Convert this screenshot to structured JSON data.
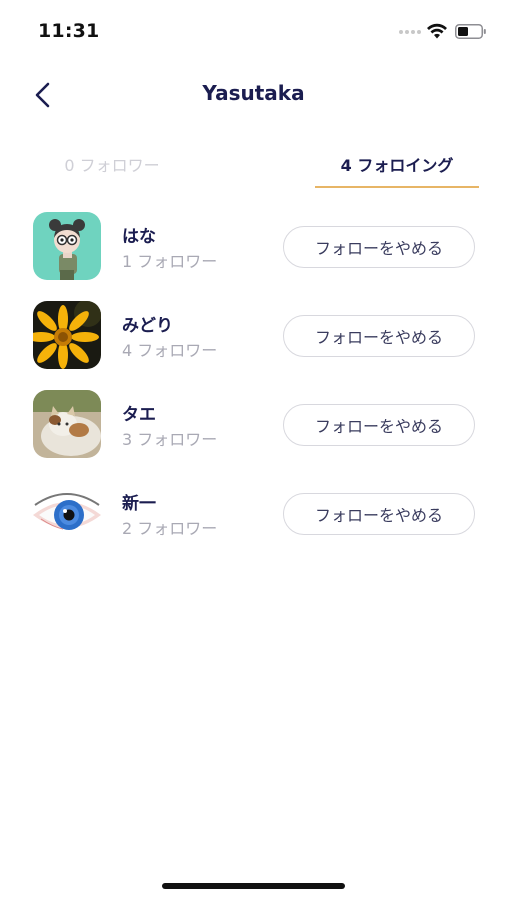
{
  "status_bar": {
    "time": "11:31"
  },
  "header": {
    "title": "Yasutaka",
    "back_icon": "chevron-left-icon"
  },
  "tabs": {
    "followers_label": "0 フォロワー",
    "following_label": "4 フォロイング",
    "active_tab": "following",
    "accent_color": "#e7b566"
  },
  "users": [
    {
      "name": "はな",
      "followers": "1 フォロワー",
      "button_label": "フォローをやめる",
      "avatar": "character-avatar"
    },
    {
      "name": "みどり",
      "followers": "4 フォロワー",
      "button_label": "フォローをやめる",
      "avatar": "yellow-flower-photo"
    },
    {
      "name": "タエ",
      "followers": "3 フォロワー",
      "button_label": "フォローをやめる",
      "avatar": "cat-photo"
    },
    {
      "name": "新一",
      "followers": "2 フォロワー",
      "button_label": "フォローをやめる",
      "avatar": "blue-eye-photo"
    }
  ]
}
